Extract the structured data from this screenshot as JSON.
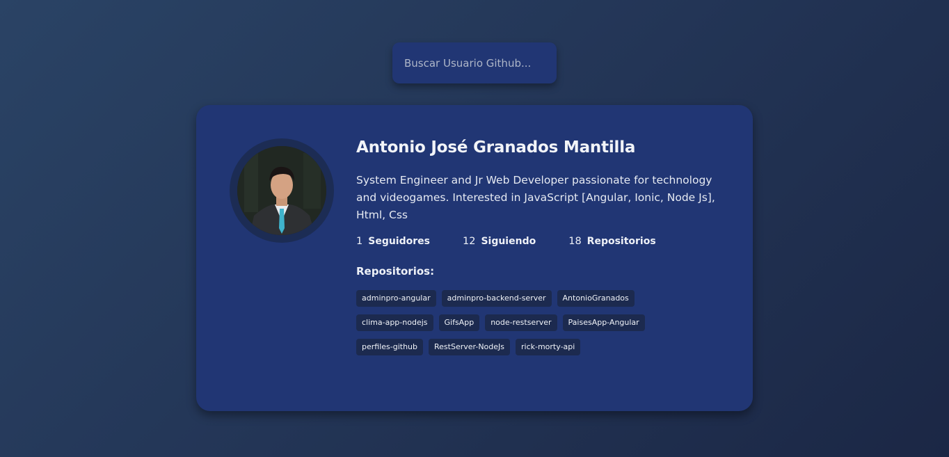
{
  "search": {
    "placeholder": "Buscar Usuario Github...",
    "value": ""
  },
  "profile": {
    "name": "Antonio José Granados Mantilla",
    "bio": "System Engineer and Jr Web Developer passionate for technology and videogames. Interested in JavaScript [Angular, Ionic, Node Js], Html, Css",
    "stats": [
      {
        "count": "1",
        "label": "Seguidores"
      },
      {
        "count": "12",
        "label": "Siguiendo"
      },
      {
        "count": "18",
        "label": "Repositorios"
      }
    ]
  },
  "repos": {
    "title": "Repositorios:",
    "items": [
      "adminpro-angular",
      "adminpro-backend-server",
      "AntonioGranados",
      "clima-app-nodejs",
      "GifsApp",
      "node-restserver",
      "PaisesApp-Angular",
      "perfiles-github",
      "RestServer-NodeJs",
      "rick-morty-api"
    ]
  },
  "colors": {
    "background": "#233556",
    "card": "#213674",
    "tag": "#1c2a4f",
    "avatar_ring": "#1c2c54"
  }
}
